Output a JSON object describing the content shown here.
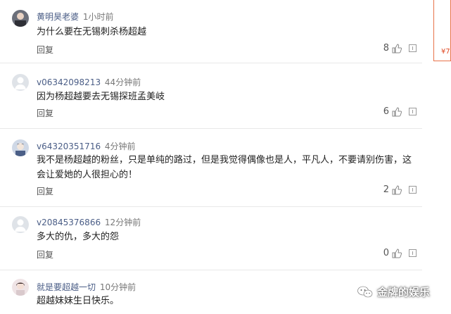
{
  "comments": [
    {
      "user": "黄明昊老婆",
      "time": "1小时前",
      "text": "为什么要在无锡刺杀杨超越",
      "reply": "回复",
      "likes": "8"
    },
    {
      "user": "v06342098213",
      "time": "44分钟前",
      "text": "因为杨超越要去无锡探班孟美岐",
      "reply": "回复",
      "likes": "6"
    },
    {
      "user": "v64320351716",
      "time": "4分钟前",
      "text": "我不是杨超越的粉丝，只是单纯的路过，但是我觉得偶像也是人，平凡人，不要请别伤害，这会让爱她的人很担心的！",
      "reply": "回复",
      "likes": "2"
    },
    {
      "user": "v20845376866",
      "time": "12分钟前",
      "text": "多大的仇，多大的怨",
      "reply": "回复",
      "likes": "0"
    },
    {
      "user": "就是要超越一切",
      "time": "10分钟前",
      "text": "超越妹妹生日快乐。",
      "reply": "",
      "likes": ""
    }
  ],
  "sidebar": {
    "price_fragment": "¥7"
  },
  "watermark": {
    "text": "金牌的娱乐"
  },
  "colors": {
    "username": "#4a5d86",
    "accent": "#e8734a"
  }
}
